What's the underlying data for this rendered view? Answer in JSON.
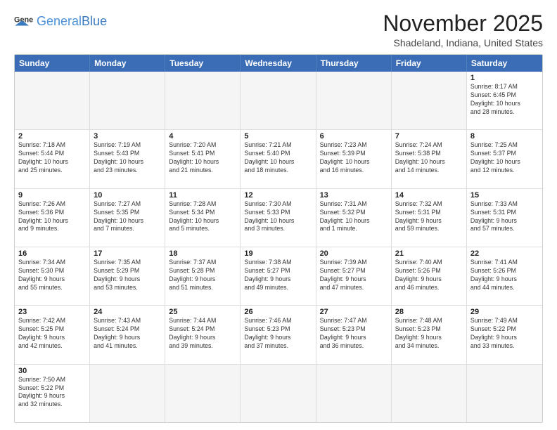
{
  "header": {
    "logo_general": "General",
    "logo_blue": "Blue",
    "month_title": "November 2025",
    "location": "Shadeland, Indiana, United States"
  },
  "days_of_week": [
    "Sunday",
    "Monday",
    "Tuesday",
    "Wednesday",
    "Thursday",
    "Friday",
    "Saturday"
  ],
  "rows": [
    [
      {
        "day": "",
        "info": "",
        "empty": true
      },
      {
        "day": "",
        "info": "",
        "empty": true
      },
      {
        "day": "",
        "info": "",
        "empty": true
      },
      {
        "day": "",
        "info": "",
        "empty": true
      },
      {
        "day": "",
        "info": "",
        "empty": true
      },
      {
        "day": "",
        "info": "",
        "empty": true
      },
      {
        "day": "1",
        "info": "Sunrise: 8:17 AM\nSunset: 6:45 PM\nDaylight: 10 hours\nand 28 minutes.",
        "empty": false
      }
    ],
    [
      {
        "day": "2",
        "info": "Sunrise: 7:18 AM\nSunset: 5:44 PM\nDaylight: 10 hours\nand 25 minutes.",
        "empty": false
      },
      {
        "day": "3",
        "info": "Sunrise: 7:19 AM\nSunset: 5:43 PM\nDaylight: 10 hours\nand 23 minutes.",
        "empty": false
      },
      {
        "day": "4",
        "info": "Sunrise: 7:20 AM\nSunset: 5:41 PM\nDaylight: 10 hours\nand 21 minutes.",
        "empty": false
      },
      {
        "day": "5",
        "info": "Sunrise: 7:21 AM\nSunset: 5:40 PM\nDaylight: 10 hours\nand 18 minutes.",
        "empty": false
      },
      {
        "day": "6",
        "info": "Sunrise: 7:23 AM\nSunset: 5:39 PM\nDaylight: 10 hours\nand 16 minutes.",
        "empty": false
      },
      {
        "day": "7",
        "info": "Sunrise: 7:24 AM\nSunset: 5:38 PM\nDaylight: 10 hours\nand 14 minutes.",
        "empty": false
      },
      {
        "day": "8",
        "info": "Sunrise: 7:25 AM\nSunset: 5:37 PM\nDaylight: 10 hours\nand 12 minutes.",
        "empty": false
      }
    ],
    [
      {
        "day": "9",
        "info": "Sunrise: 7:26 AM\nSunset: 5:36 PM\nDaylight: 10 hours\nand 9 minutes.",
        "empty": false
      },
      {
        "day": "10",
        "info": "Sunrise: 7:27 AM\nSunset: 5:35 PM\nDaylight: 10 hours\nand 7 minutes.",
        "empty": false
      },
      {
        "day": "11",
        "info": "Sunrise: 7:28 AM\nSunset: 5:34 PM\nDaylight: 10 hours\nand 5 minutes.",
        "empty": false
      },
      {
        "day": "12",
        "info": "Sunrise: 7:30 AM\nSunset: 5:33 PM\nDaylight: 10 hours\nand 3 minutes.",
        "empty": false
      },
      {
        "day": "13",
        "info": "Sunrise: 7:31 AM\nSunset: 5:32 PM\nDaylight: 10 hours\nand 1 minute.",
        "empty": false
      },
      {
        "day": "14",
        "info": "Sunrise: 7:32 AM\nSunset: 5:31 PM\nDaylight: 9 hours\nand 59 minutes.",
        "empty": false
      },
      {
        "day": "15",
        "info": "Sunrise: 7:33 AM\nSunset: 5:31 PM\nDaylight: 9 hours\nand 57 minutes.",
        "empty": false
      }
    ],
    [
      {
        "day": "16",
        "info": "Sunrise: 7:34 AM\nSunset: 5:30 PM\nDaylight: 9 hours\nand 55 minutes.",
        "empty": false
      },
      {
        "day": "17",
        "info": "Sunrise: 7:35 AM\nSunset: 5:29 PM\nDaylight: 9 hours\nand 53 minutes.",
        "empty": false
      },
      {
        "day": "18",
        "info": "Sunrise: 7:37 AM\nSunset: 5:28 PM\nDaylight: 9 hours\nand 51 minutes.",
        "empty": false
      },
      {
        "day": "19",
        "info": "Sunrise: 7:38 AM\nSunset: 5:27 PM\nDaylight: 9 hours\nand 49 minutes.",
        "empty": false
      },
      {
        "day": "20",
        "info": "Sunrise: 7:39 AM\nSunset: 5:27 PM\nDaylight: 9 hours\nand 47 minutes.",
        "empty": false
      },
      {
        "day": "21",
        "info": "Sunrise: 7:40 AM\nSunset: 5:26 PM\nDaylight: 9 hours\nand 46 minutes.",
        "empty": false
      },
      {
        "day": "22",
        "info": "Sunrise: 7:41 AM\nSunset: 5:26 PM\nDaylight: 9 hours\nand 44 minutes.",
        "empty": false
      }
    ],
    [
      {
        "day": "23",
        "info": "Sunrise: 7:42 AM\nSunset: 5:25 PM\nDaylight: 9 hours\nand 42 minutes.",
        "empty": false
      },
      {
        "day": "24",
        "info": "Sunrise: 7:43 AM\nSunset: 5:24 PM\nDaylight: 9 hours\nand 41 minutes.",
        "empty": false
      },
      {
        "day": "25",
        "info": "Sunrise: 7:44 AM\nSunset: 5:24 PM\nDaylight: 9 hours\nand 39 minutes.",
        "empty": false
      },
      {
        "day": "26",
        "info": "Sunrise: 7:46 AM\nSunset: 5:23 PM\nDaylight: 9 hours\nand 37 minutes.",
        "empty": false
      },
      {
        "day": "27",
        "info": "Sunrise: 7:47 AM\nSunset: 5:23 PM\nDaylight: 9 hours\nand 36 minutes.",
        "empty": false
      },
      {
        "day": "28",
        "info": "Sunrise: 7:48 AM\nSunset: 5:23 PM\nDaylight: 9 hours\nand 34 minutes.",
        "empty": false
      },
      {
        "day": "29",
        "info": "Sunrise: 7:49 AM\nSunset: 5:22 PM\nDaylight: 9 hours\nand 33 minutes.",
        "empty": false
      }
    ],
    [
      {
        "day": "30",
        "info": "Sunrise: 7:50 AM\nSunset: 5:22 PM\nDaylight: 9 hours\nand 32 minutes.",
        "empty": false
      },
      {
        "day": "",
        "info": "",
        "empty": true
      },
      {
        "day": "",
        "info": "",
        "empty": true
      },
      {
        "day": "",
        "info": "",
        "empty": true
      },
      {
        "day": "",
        "info": "",
        "empty": true
      },
      {
        "day": "",
        "info": "",
        "empty": true
      },
      {
        "day": "",
        "info": "",
        "empty": true
      }
    ]
  ]
}
